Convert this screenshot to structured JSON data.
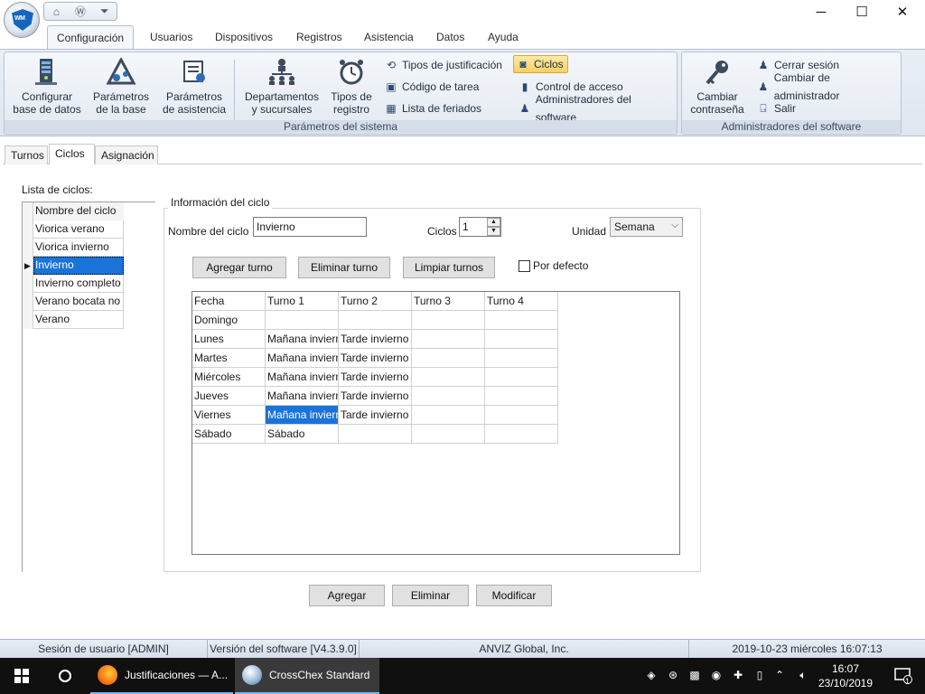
{
  "app": {
    "logo_text": "WM",
    "window_controls": {
      "minimize": "─",
      "maximize": "☐",
      "close": "✕"
    }
  },
  "ribbon": {
    "tabs": [
      "Configuración",
      "Usuarios",
      "Dispositivos",
      "Registros",
      "Asistencia",
      "Datos",
      "Ayuda"
    ],
    "active_tab": "Configuración",
    "group_system": {
      "title": "Parámetros del sistema",
      "btn_db": [
        "Configurar",
        "base de datos"
      ],
      "btn_base": [
        "Parámetros",
        "de la base"
      ],
      "btn_att": [
        "Parámetros",
        "de asistencia"
      ],
      "btn_dept": [
        "Departamentos",
        "y sucursales"
      ],
      "btn_types": [
        "Tipos de",
        "registro"
      ],
      "small": [
        "Tipos de justificación",
        "Código de tarea",
        "Lista de feriados",
        "Ciclos",
        "Control de acceso",
        "Administradores del software"
      ]
    },
    "group_admin": {
      "title": "Administradores del software",
      "btn_pwd": [
        "Cambiar",
        "contraseña"
      ],
      "small": [
        "Cerrar sesión",
        "Cambiar de administrador",
        "Salir"
      ]
    }
  },
  "page_tabs": [
    "Turnos",
    "Ciclos",
    "Asignación"
  ],
  "cycle_list": {
    "label": "Lista de ciclos:",
    "header": "Nombre del ciclo",
    "items": [
      "Viorica verano",
      "Viorica invierno",
      "Invierno",
      "Invierno completo",
      "Verano bocata no",
      "Verano"
    ],
    "selected_index": 2,
    "indicator": "▶"
  },
  "cycle_info": {
    "legend": "Información del ciclo",
    "name_label": "Nombre del ciclo",
    "name_value": "Invierno",
    "cycles_label": "Ciclos",
    "cycles_value": "1",
    "unit_label": "Unidad",
    "unit_value": "Semana",
    "btn_add_shift": "Agregar turno",
    "btn_remove_shift": "Eliminar turno",
    "btn_clear_shifts": "Limpiar turnos",
    "default_label": "Por defecto"
  },
  "grid": {
    "columns": [
      "Fecha",
      "Turno 1",
      "Turno 2",
      "Turno 3",
      "Turno 4"
    ],
    "rows": [
      [
        "Domingo",
        "",
        "",
        "",
        ""
      ],
      [
        "Lunes",
        "Mañana invierno",
        "Tarde invierno",
        "",
        ""
      ],
      [
        "Martes",
        "Mañana invierno",
        "Tarde invierno",
        "",
        ""
      ],
      [
        "Miércoles",
        "Mañana invierno",
        "Tarde invierno",
        "",
        ""
      ],
      [
        "Jueves",
        "Mañana invierno",
        "Tarde invierno",
        "",
        ""
      ],
      [
        "Viernes",
        "Mañana invierno",
        "Tarde invierno",
        "",
        ""
      ],
      [
        "Sábado",
        "Sábado",
        "",
        "",
        ""
      ]
    ]
  },
  "actions": {
    "add": "Agregar",
    "delete": "Eliminar",
    "modify": "Modificar"
  },
  "statusbar": {
    "session": "Sesión de usuario  [ADMIN]",
    "version": "Versión del software  [V4.3.9.0]",
    "company": "ANVIZ Global, Inc.",
    "datetime": "2019-10-23 miércoles 16:07:13"
  },
  "taskbar": {
    "app1": "Justificaciones — A...",
    "app2": "CrossChex Standard",
    "time": "16:07",
    "date": "23/10/2019",
    "notifications": "1"
  }
}
